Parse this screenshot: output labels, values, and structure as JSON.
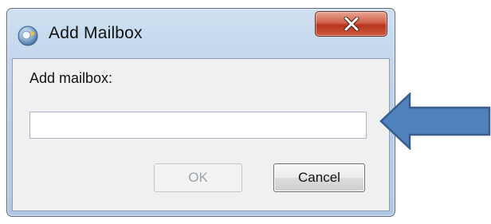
{
  "window": {
    "title": "Add Mailbox",
    "icon": "mailbox-app-icon",
    "close_icon": "close-icon"
  },
  "form": {
    "label": "Add mailbox:",
    "input_value": "",
    "input_placeholder": ""
  },
  "buttons": {
    "ok_label": "OK",
    "ok_enabled": false,
    "cancel_label": "Cancel"
  },
  "annotation": {
    "arrow_icon": "left-arrow-icon",
    "arrow_color": "#4f81bd"
  },
  "colors": {
    "close_button": "#c9442b",
    "frame": "#bcd2ea",
    "client_background": "#f0f0f0"
  }
}
